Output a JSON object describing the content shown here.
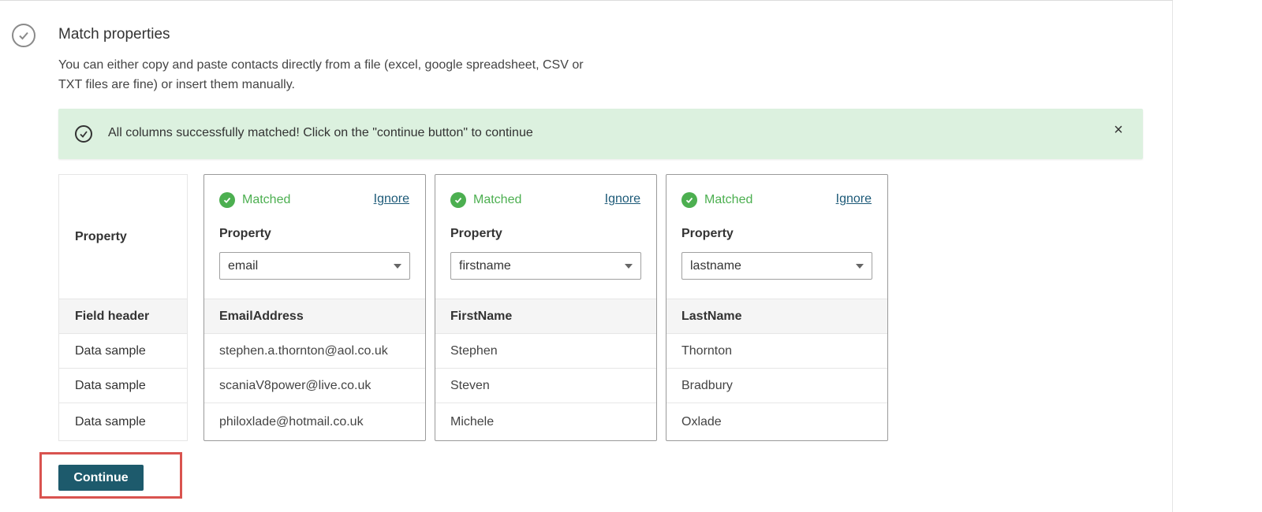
{
  "step": {
    "icon": "check-circle-icon",
    "title": "Match properties",
    "description": "You can either copy and paste contacts directly from a file (excel, google spreadsheet, CSV or TXT files are fine) or insert them manually."
  },
  "alert": {
    "icon": "check-circle-icon",
    "text": "All columns successfully matched! Click on the \"continue button\" to continue",
    "close_icon": "close-icon",
    "close_glyph": "×",
    "background": "#dcf1df"
  },
  "labels": {
    "property": "Property",
    "field_header": "Field header",
    "data_sample": "Data sample"
  },
  "columns": [
    {
      "status": "Matched",
      "ignore": "Ignore",
      "property_label": "Property",
      "selected": "email",
      "field_header": "EmailAddress",
      "samples": [
        "stephen.a.thornton@aol.co.uk",
        "scaniaV8power@live.co.uk",
        "philoxlade@hotmail.co.uk"
      ]
    },
    {
      "status": "Matched",
      "ignore": "Ignore",
      "property_label": "Property",
      "selected": "firstname",
      "field_header": "FirstName",
      "samples": [
        "Stephen",
        "Steven",
        "Michele"
      ]
    },
    {
      "status": "Matched",
      "ignore": "Ignore",
      "property_label": "Property",
      "selected": "lastname",
      "field_header": "LastName",
      "samples": [
        "Thornton",
        "Bradbury",
        "Oxlade"
      ]
    }
  ],
  "continue_button": "Continue",
  "colors": {
    "matched": "#4caf50",
    "link": "#1d5a78",
    "primary_button": "#1d5a6c",
    "highlight": "#d9534f"
  }
}
